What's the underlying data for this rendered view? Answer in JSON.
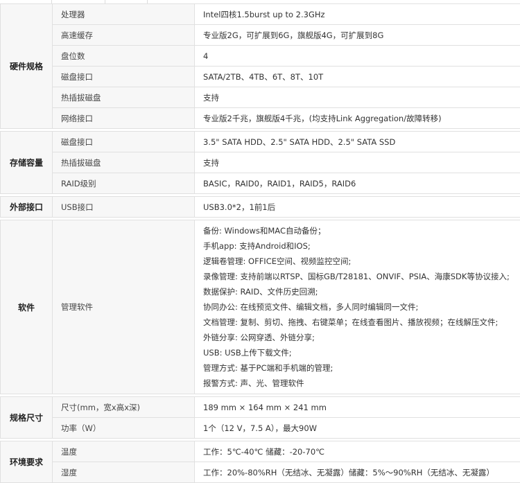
{
  "sections": [
    {
      "category": "硬件规格",
      "rows": [
        {
          "key": "处理器",
          "value": "Intel四核1.5burst up to 2.3GHz"
        },
        {
          "key": "高速缓存",
          "value": "专业版2G，可扩展到6G，旗舰版4G，可扩展到8G"
        },
        {
          "key": "盘位数",
          "value": "4"
        },
        {
          "key": "磁盘接口",
          "value": "SATA/2TB、4TB、6T、8T、10T"
        },
        {
          "key": "热插拔磁盘",
          "value": "支持"
        },
        {
          "key": "网络接口",
          "value": "专业版2千兆，旗舰版4千兆，(均支持Link Aggregation/故障转移)"
        }
      ]
    },
    {
      "category": "存储容量",
      "rows": [
        {
          "key": "磁盘接口",
          "value": "3.5\" SATA HDD、2.5\" SATA HDD、2.5\" SATA SSD"
        },
        {
          "key": "热插拔磁盘",
          "value": "支持"
        },
        {
          "key": "RAID级别",
          "value": "BASIC，RAID0，RAID1，RAID5，RAID6"
        }
      ]
    },
    {
      "category": "外部接口",
      "rows": [
        {
          "key": "USB接口",
          "value": "USB3.0*2，1前1后"
        }
      ]
    },
    {
      "category": "软件",
      "rows": [
        {
          "key": "管理软件",
          "lines": [
            "备份: Windows和MAC自动备份；",
            "手机app: 支持Android和IOS;",
            "逻辑卷管理: OFFICE空间、视频监控空间;",
            "录像管理: 支持前端以RTSP、国标GB/T28181、ONVIF、PSIA、海康SDK等协议接入;",
            "数据保护: RAID、文件历史回溯;",
            "协同办公: 在线预览文件、编辑文档，多人同时编辑同一文件;",
            "文档管理: 复制、剪切、拖拽、右键菜单；在线查看图片、播放视频；在线解压文件;",
            "外链分享: 公网穿透、外链分享;",
            "USB: USB上传下载文件;",
            "管理方式: 基于PC端和手机端的管理;",
            "报警方式: 声、光、管理软件"
          ]
        }
      ]
    },
    {
      "category": "规格尺寸",
      "rows": [
        {
          "key": "尺寸(mm，宽x高x深)",
          "value": "189 mm × 164 mm ×  241 mm"
        },
        {
          "key": "功率（W）",
          "value": "1个（12 V，7.5 A），最大90W"
        }
      ]
    },
    {
      "category": "环境要求",
      "rows": [
        {
          "key": "温度",
          "value": "工作：5℃-40℃ 储藏：-20-70℃"
        },
        {
          "key": "湿度",
          "value": "工作：20%-80%RH（无结冰、无凝露）储藏：5%～90%RH（无结冰、无凝露）"
        }
      ]
    }
  ]
}
